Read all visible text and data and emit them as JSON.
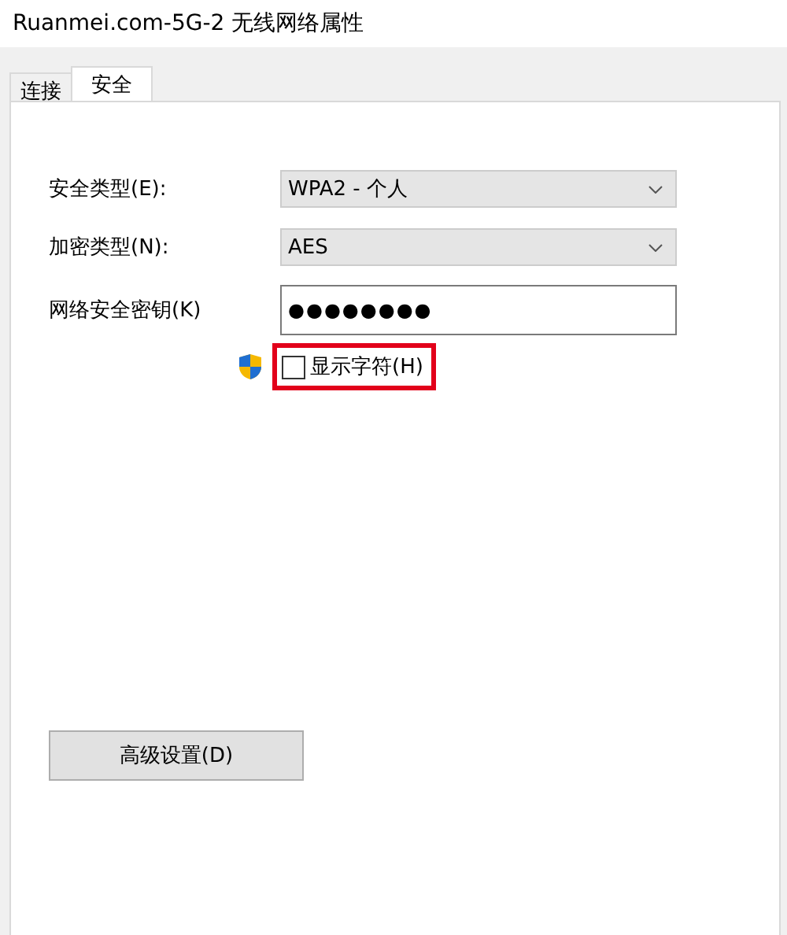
{
  "window": {
    "title": "Ruanmei.com-5G-2 无线网络属性"
  },
  "tabs": [
    {
      "label": "连接",
      "selected": false
    },
    {
      "label": "安全",
      "selected": true
    }
  ],
  "fields": [
    {
      "kind": "dropdown",
      "label": "安全类型(E):",
      "value": "WPA2 - 个人"
    },
    {
      "kind": "dropdown",
      "label": "加密类型(N):",
      "value": "AES"
    },
    {
      "kind": "text",
      "label": "网络安全密钥(K)",
      "value": "●●●●●●●●"
    }
  ],
  "show_characters": {
    "label": "显示字符(H)",
    "checked": false,
    "highlighted": true
  },
  "buttons": [
    {
      "label": "高级设置(D)"
    }
  ]
}
